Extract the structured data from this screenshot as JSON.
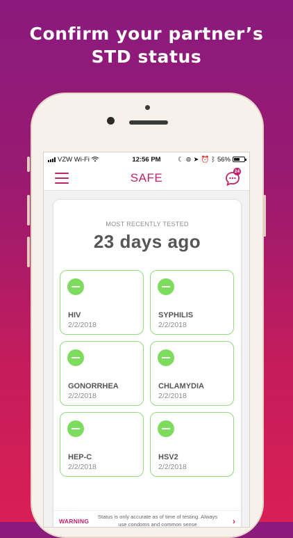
{
  "headline": [
    "Confirm your partner’s",
    "STD status"
  ],
  "status_bar": {
    "carrier": "VZW Wi-Fi",
    "time": "12:56 PM",
    "battery": "56%",
    "battery_level": 0.56
  },
  "app": {
    "title": "SAFE",
    "chat_badge": "24"
  },
  "summary": {
    "label": "MOST RECENTLY TESTED",
    "value": "23 days ago"
  },
  "tests": [
    {
      "name": "HIV",
      "date": "2/2/2018"
    },
    {
      "name": "SYPHILIS",
      "date": "2/2/2018"
    },
    {
      "name": "GONORRHEA",
      "date": "2/2/2018"
    },
    {
      "name": "CHLAMYDIA",
      "date": "2/2/2018"
    },
    {
      "name": "HEP-C",
      "date": "2/2/2018"
    },
    {
      "name": "HSV2",
      "date": "2/2/2018"
    }
  ],
  "warning": {
    "label": "WARNING",
    "text": "Status is only accurate as of time of testing. Always use condoms and common sense"
  },
  "colors": {
    "accent": "#c3206a",
    "negative_green": "#7ddc5e",
    "tile_border": "#8fdb7c"
  }
}
